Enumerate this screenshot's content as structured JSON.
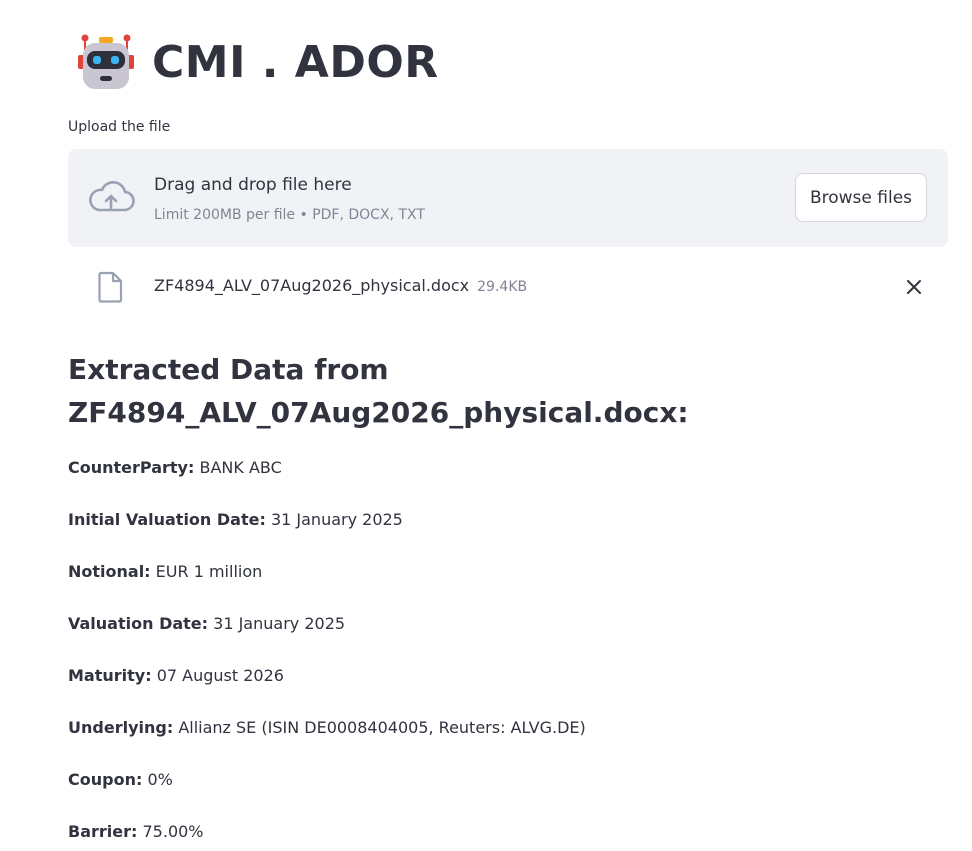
{
  "app": {
    "title": "CMI . ADOR",
    "logo_icon": "robot-icon"
  },
  "uploader": {
    "label": "Upload the file",
    "drop_text": "Drag and drop file here",
    "limit_text": "Limit 200MB per file • PDF, DOCX, TXT",
    "browse_label": "Browse files",
    "upload_icon": "cloud-upload-icon"
  },
  "uploaded_file": {
    "name": "ZF4894_ALV_07Aug2026_physical.docx",
    "size": "29.4KB",
    "file_icon": "document-icon",
    "remove_icon": "close-icon"
  },
  "extracted": {
    "heading": "Extracted Data from ZF4894_ALV_07Aug2026_physical.docx:",
    "fields": [
      {
        "key": "CounterParty:",
        "value": "BANK ABC"
      },
      {
        "key": "Initial Valuation Date:",
        "value": "31 January 2025"
      },
      {
        "key": "Notional:",
        "value": "EUR 1 million"
      },
      {
        "key": "Valuation Date:",
        "value": "31 January 2025"
      },
      {
        "key": "Maturity:",
        "value": "07 August 2026"
      },
      {
        "key": "Underlying:",
        "value": "Allianz SE (ISIN DE0008404005, Reuters: ALVG.DE)"
      },
      {
        "key": "Coupon:",
        "value": "0%"
      },
      {
        "key": "Barrier:",
        "value": "75.00%"
      }
    ]
  },
  "colors": {
    "text": "#31333f",
    "muted": "#808495",
    "dropzone_bg": "#f0f2f6"
  }
}
